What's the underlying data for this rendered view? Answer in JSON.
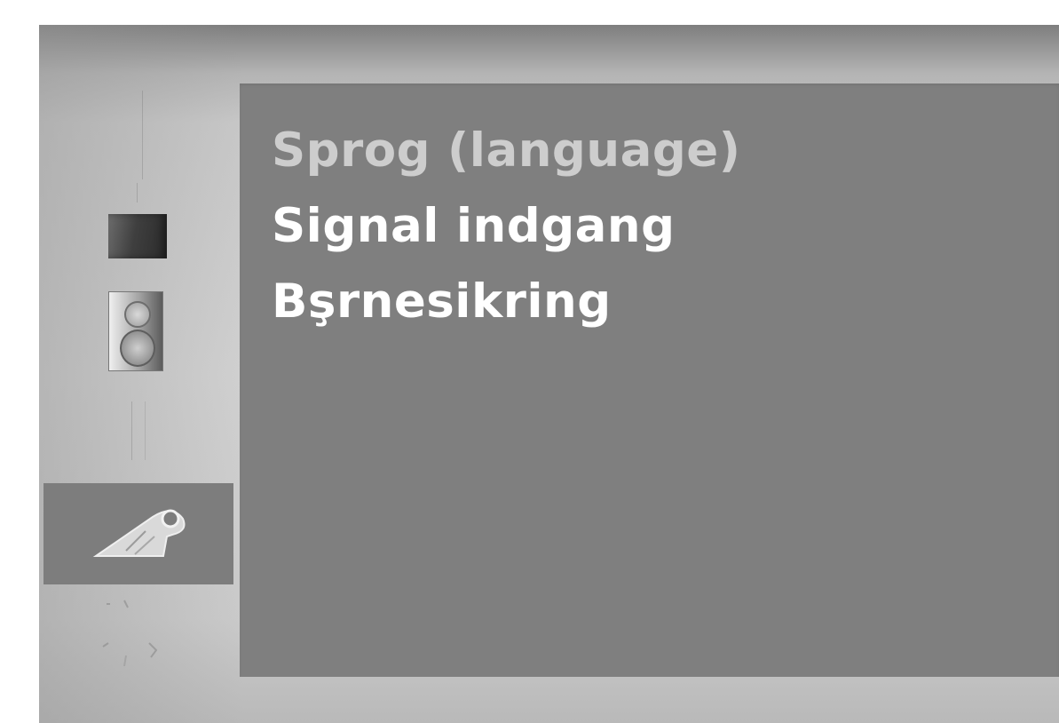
{
  "sidebar": {
    "icons": [
      {
        "name": "picture-icon",
        "selected": false
      },
      {
        "name": "sound-icon",
        "selected": false
      },
      {
        "name": "timer-icon",
        "selected": false
      },
      {
        "name": "special-icon",
        "selected": true
      },
      {
        "name": "screen-icon",
        "selected": false
      }
    ]
  },
  "menu": {
    "items": [
      {
        "label": "Sprog (language)",
        "highlighted": true
      },
      {
        "label": "Signal indgang",
        "highlighted": false
      },
      {
        "label": "Bşrnesikring",
        "highlighted": false
      }
    ]
  },
  "colors": {
    "panel": "#7f7f7f",
    "selected_tab": "#7d7d7d",
    "item_text": "#ffffff",
    "highlighted_item_text": "#cdcdcd"
  }
}
